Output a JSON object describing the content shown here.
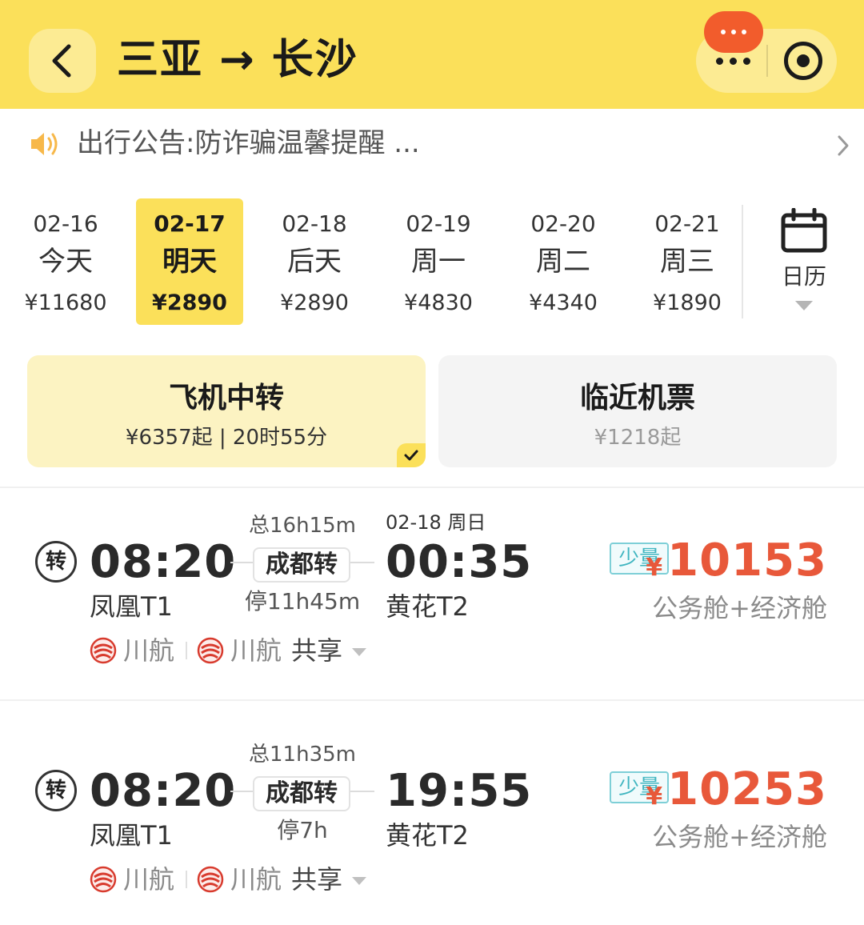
{
  "header": {
    "title": "三亚 → 长沙",
    "colors": {
      "background": "#fbe05a",
      "badge": "#f25c2c"
    }
  },
  "notice": {
    "text": "出行公告:防诈骗温馨提醒 ..."
  },
  "dates": [
    {
      "date": "02-16",
      "weekday": "今天",
      "price": "¥11680"
    },
    {
      "date": "02-17",
      "weekday": "明天",
      "price": "¥2890",
      "selected": true
    },
    {
      "date": "02-18",
      "weekday": "后天",
      "price": "¥2890"
    },
    {
      "date": "02-19",
      "weekday": "周一",
      "price": "¥4830"
    },
    {
      "date": "02-20",
      "weekday": "周二",
      "price": "¥4340"
    },
    {
      "date": "02-21",
      "weekday": "周三",
      "price": "¥1890"
    }
  ],
  "calendar": {
    "label": "日历"
  },
  "tabs": [
    {
      "title": "飞机中转",
      "subtitle": "¥6357起 | 20时55分",
      "selected": true
    },
    {
      "title": "临近机票",
      "subtitle": "¥1218起"
    }
  ],
  "flights": [
    {
      "transfer_icon": "转",
      "dep_time": "08:20",
      "dep_airport": "凤凰T1",
      "total_duration": "总16h15m",
      "transfer_city": "成都转",
      "stop_duration": "停11h45m",
      "arr_date": "02-18 周日",
      "arr_time": "00:35",
      "arr_airport": "黄花T2",
      "badge": "少量",
      "currency": "¥",
      "price": "10153",
      "cabin": "公务舱+经济舱",
      "airline1": "川航",
      "airline2": "川航",
      "shared": "共享"
    },
    {
      "transfer_icon": "转",
      "dep_time": "08:20",
      "dep_airport": "凤凰T1",
      "total_duration": "总11h35m",
      "transfer_city": "成都转",
      "stop_duration": "停7h",
      "arr_time": "19:55",
      "arr_airport": "黄花T2",
      "badge": "少量",
      "currency": "¥",
      "price": "10253",
      "cabin": "公务舱+经济舱",
      "airline1": "川航",
      "airline2": "川航",
      "shared": "共享"
    }
  ],
  "colors": {
    "accent": "#fbe05a",
    "price": "#e8583a",
    "badge": "#3fb5c0"
  }
}
